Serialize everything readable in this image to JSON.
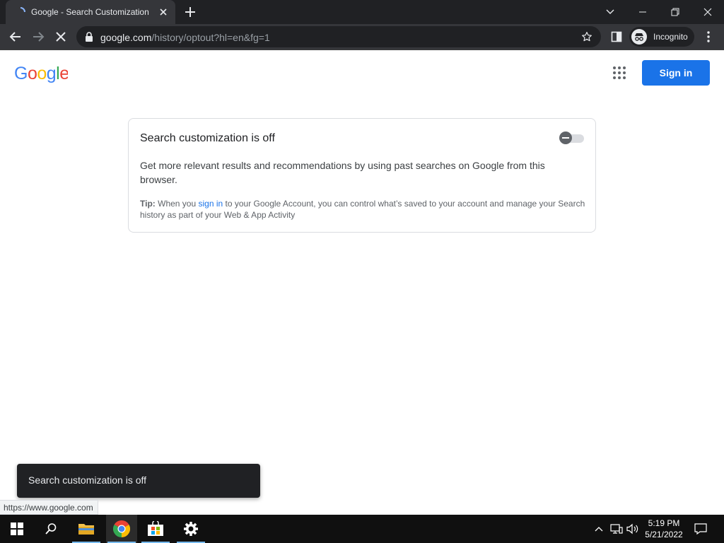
{
  "browser": {
    "tab": {
      "title": "Google - Search Customization"
    },
    "address": {
      "host": "google.com",
      "path": "/history/optout?hl=en&fg=1"
    },
    "profile_label": "Incognito",
    "status_url": "https://www.google.com"
  },
  "header": {
    "sign_in_label": "Sign in"
  },
  "card": {
    "title": "Search customization is off",
    "description": "Get more relevant results and recommendations by using past searches on Google from this browser.",
    "tip_label": "Tip:",
    "tip_before": " When you ",
    "tip_link": "sign in",
    "tip_after": " to your Google Account, you can control what’s saved to your account and manage your Search history as part of your Web & App Activity",
    "toggle_on": false
  },
  "snackbar": {
    "text": "Search customization is off"
  },
  "taskbar": {
    "time": "5:19 PM",
    "date": "5/21/2022"
  },
  "colors": {
    "accent": "#1a73e8",
    "tab_bg": "#35363a",
    "frame_bg": "#202124"
  }
}
